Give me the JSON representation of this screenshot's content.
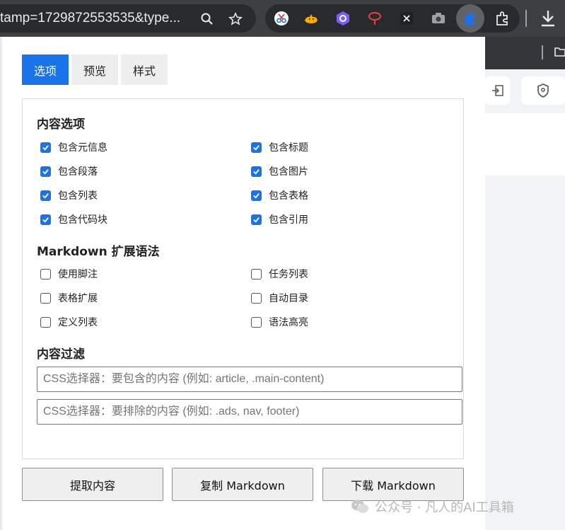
{
  "browser": {
    "url_fragment": "tamp=1729872553535&type...",
    "extensions": [
      "scissors-ext-icon",
      "cat-ext-icon",
      "purple-hex-ext-icon",
      "red-cloud-ext-icon",
      "x-ext-icon",
      "camera-ext-icon",
      "puzzle-ext-icon-active",
      "extensions-icon"
    ]
  },
  "tabs": [
    {
      "label": "选项",
      "active": true
    },
    {
      "label": "预览",
      "active": false
    },
    {
      "label": "样式",
      "active": false
    }
  ],
  "content_options": {
    "title": "内容选项",
    "items": [
      {
        "label": "包含元信息",
        "checked": true
      },
      {
        "label": "包含标题",
        "checked": true
      },
      {
        "label": "包含段落",
        "checked": true
      },
      {
        "label": "包含图片",
        "checked": true
      },
      {
        "label": "包含列表",
        "checked": true
      },
      {
        "label": "包含表格",
        "checked": true
      },
      {
        "label": "包含代码块",
        "checked": true
      },
      {
        "label": "包含引用",
        "checked": true
      }
    ]
  },
  "markdown_ext": {
    "title": "Markdown 扩展语法",
    "items": [
      {
        "label": "使用脚注",
        "checked": false
      },
      {
        "label": "任务列表",
        "checked": false
      },
      {
        "label": "表格扩展",
        "checked": false
      },
      {
        "label": "自动目录",
        "checked": false
      },
      {
        "label": "定义列表",
        "checked": false
      },
      {
        "label": "语法高亮",
        "checked": false
      }
    ]
  },
  "filter": {
    "title": "内容过滤",
    "include_placeholder": "CSS选择器：要包含的内容 (例如: article, .main-content)",
    "exclude_placeholder": "CSS选择器：要排除的内容 (例如: .ads, nav, footer)"
  },
  "actions": {
    "extract": "提取内容",
    "copy": "复制 Markdown",
    "download": "下载 Markdown"
  },
  "watermark": "公众号 · 凡人的AI工具箱",
  "colors": {
    "accent": "#1a73e8",
    "chrome_dark": "#3c4043"
  }
}
